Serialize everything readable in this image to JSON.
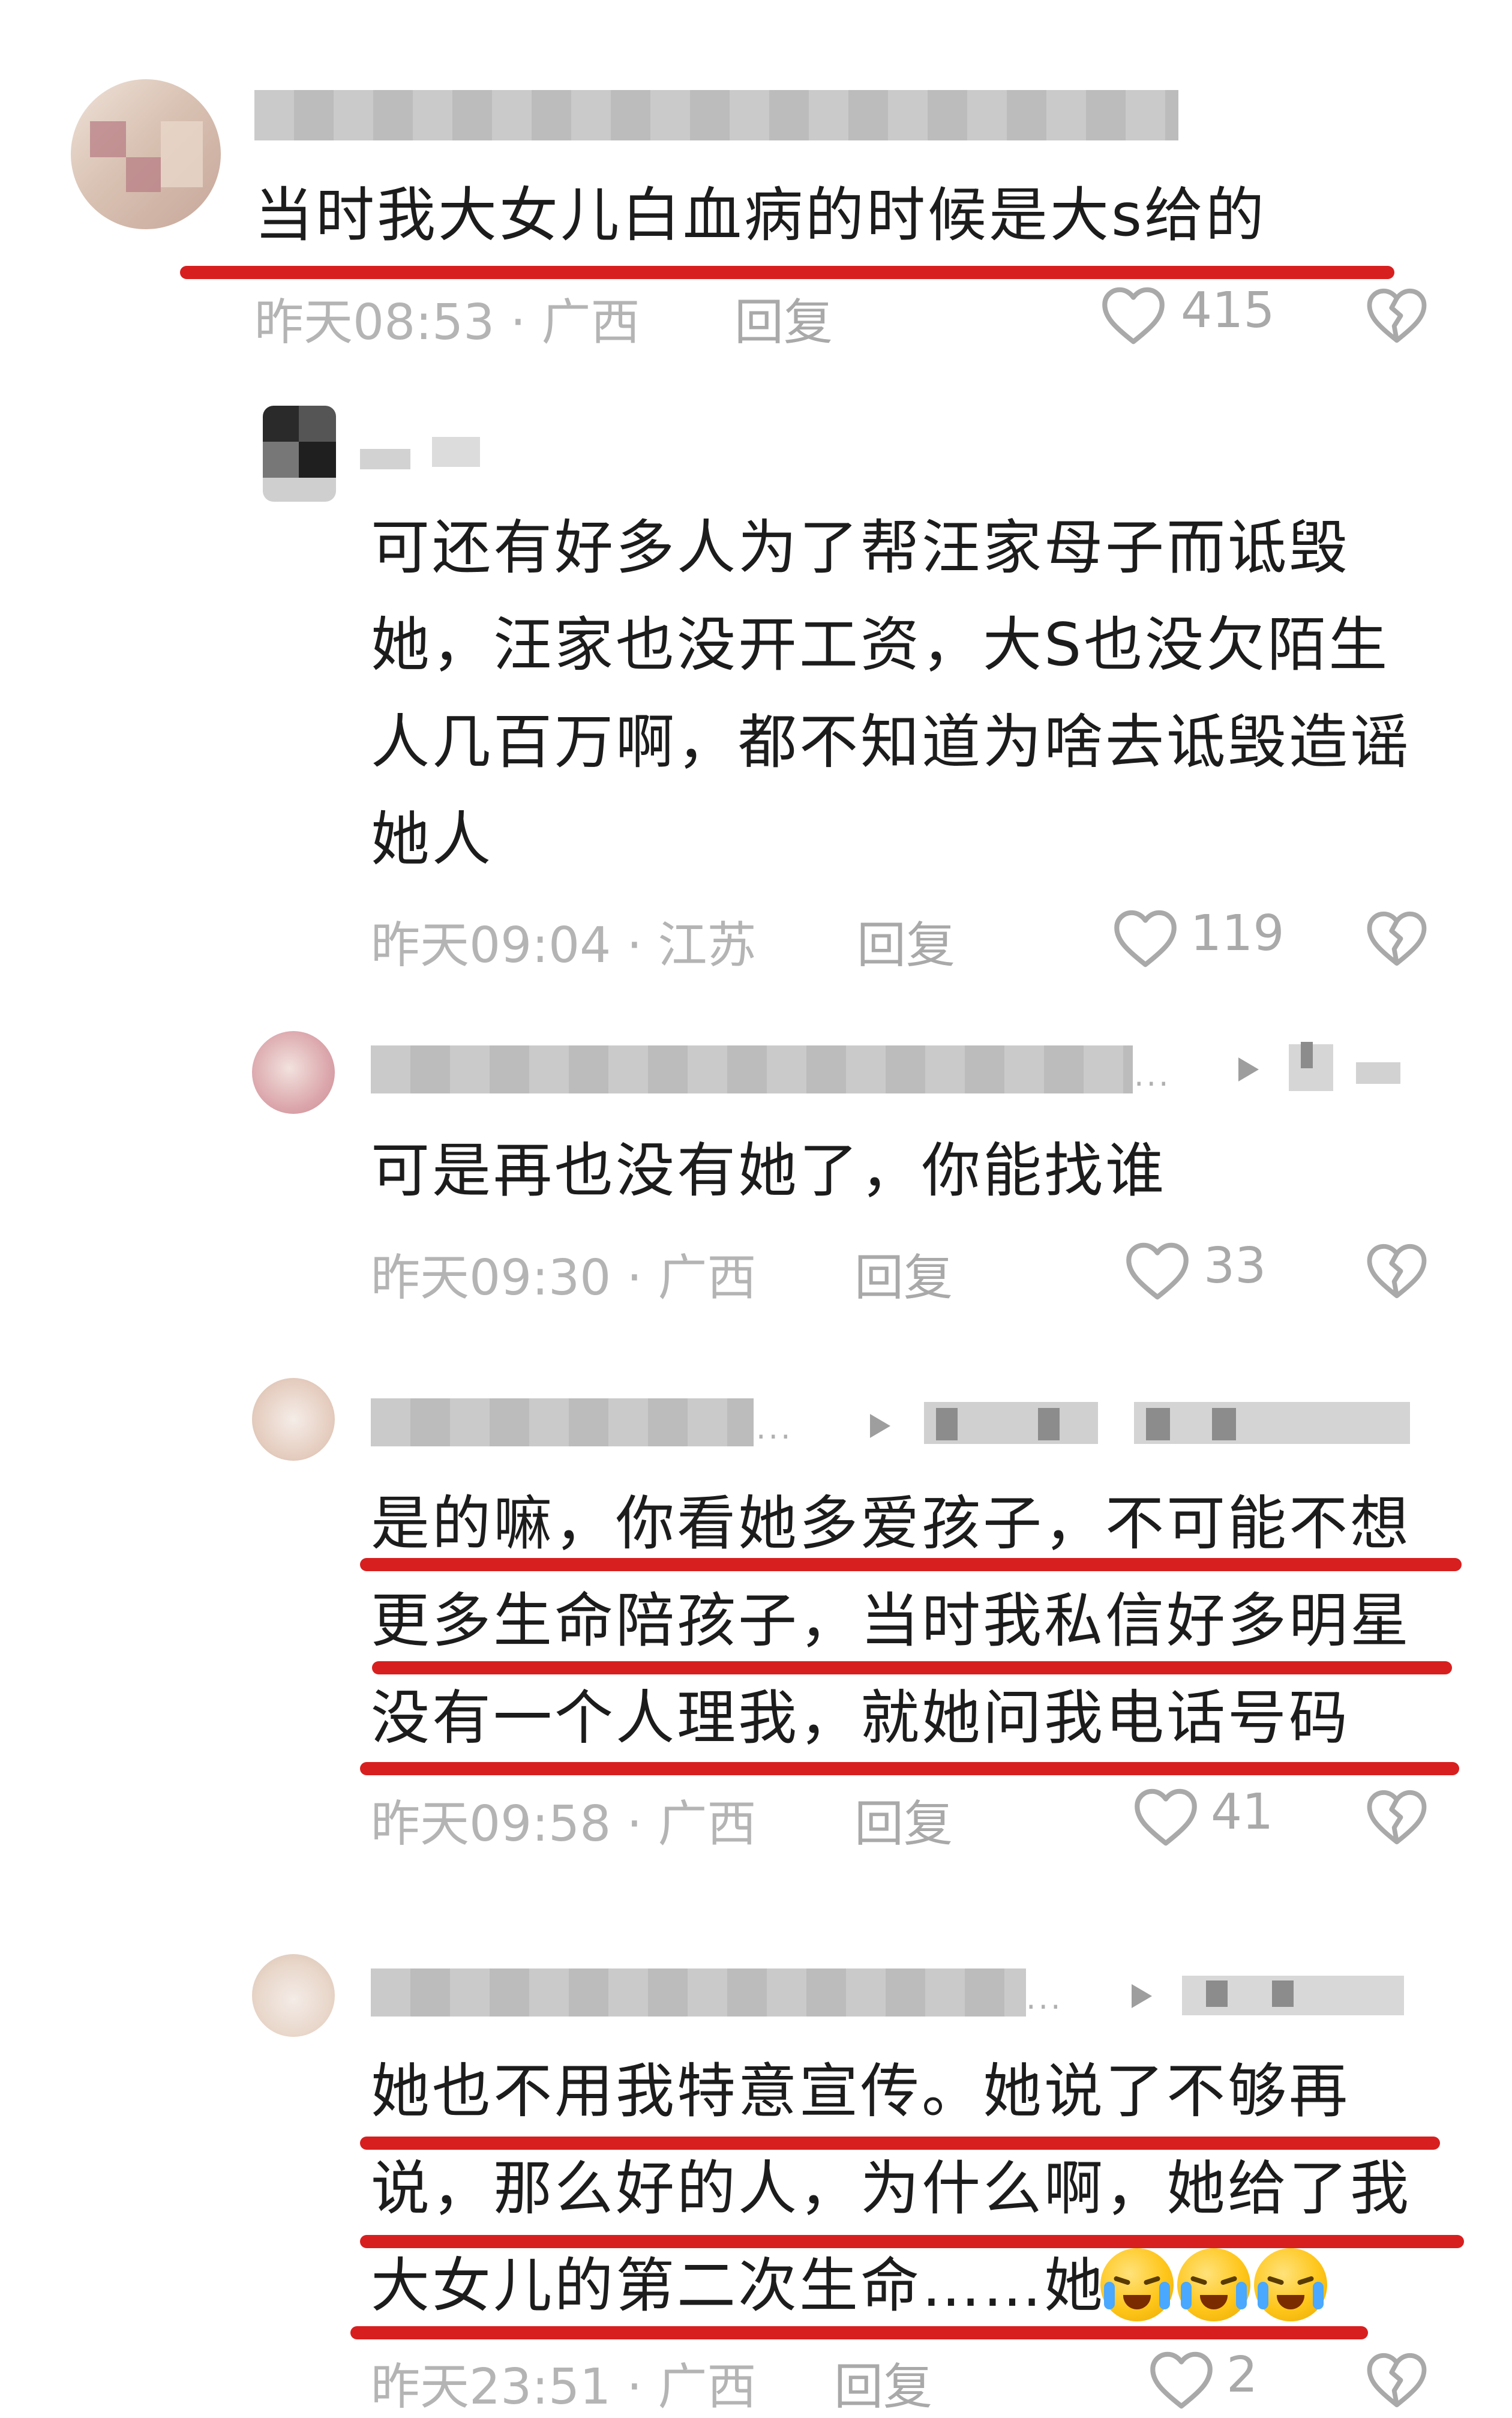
{
  "comments": [
    {
      "text": "当时我大女儿白血病的时候是大s给的",
      "time": "昨天08:53 · 广西",
      "reply": "回复",
      "likes": "415"
    },
    {
      "text": "可还有好多人为了帮汪家母子而诋毁她，汪家也没开工资，大S也没欠陌生人几百万啊，都不知道为啥去诋毁造谣她人",
      "time": "昨天09:04 · 江苏",
      "reply": "回复",
      "likes": "119"
    },
    {
      "text": "可是再也没有她了，你能找谁",
      "time": "昨天09:30 · 广西",
      "reply": "回复",
      "likes": "33"
    },
    {
      "text": "是的嘛，你看她多爱孩子，不可能不想更多生命陪孩子，当时我私信好多明星没有一个人理我，就她问我电话号码",
      "time": "昨天09:58 · 广西",
      "reply": "回复",
      "likes": "41"
    },
    {
      "text": "她也不用我特意宣传。她说了不够再说，那么好的人，为什么啊，她给了我大女儿的第二次生命……她",
      "time": "昨天23:51 · 广西",
      "reply": "回复",
      "likes": "2"
    }
  ],
  "ellipsis": "...",
  "icons": {
    "like": "heart-outline-icon",
    "dislike": "broken-heart-icon",
    "play": "play-triangle-icon",
    "emoji": "crying-face-emoji"
  },
  "colors": {
    "underline": "#d81f1f",
    "meta": "#b4b4b4",
    "text": "#1c1c1c"
  }
}
